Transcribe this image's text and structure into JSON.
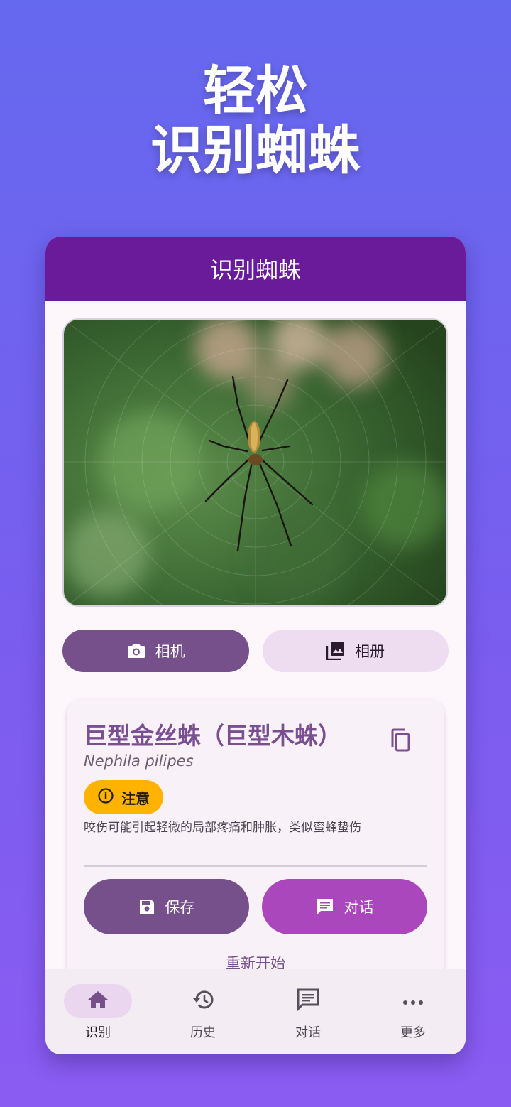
{
  "promo": {
    "line1": "轻松",
    "line2": "识别蜘蛛"
  },
  "appbar": {
    "title": "识别蜘蛛"
  },
  "buttons": {
    "camera": "相机",
    "album": "相册"
  },
  "result": {
    "name": "巨型金丝蛛（巨型木蛛）",
    "latin": "Nephila pilipes",
    "badge": "注意",
    "badge_color": "#ffb300",
    "description": "咬伤可能引起轻微的局部疼痛和肿胀，类似蜜蜂蛰伤",
    "save": "保存",
    "chat": "对话",
    "restart": "重新开始"
  },
  "nav": [
    {
      "label": "识别",
      "icon": "home-icon",
      "active": true
    },
    {
      "label": "历史",
      "icon": "history-icon",
      "active": false
    },
    {
      "label": "对话",
      "icon": "chat-icon",
      "active": false
    },
    {
      "label": "更多",
      "icon": "more-icon",
      "active": false
    }
  ],
  "colors": {
    "primary": "#6a1b9a",
    "accent": "#ab47bc",
    "button": "#76508a"
  }
}
